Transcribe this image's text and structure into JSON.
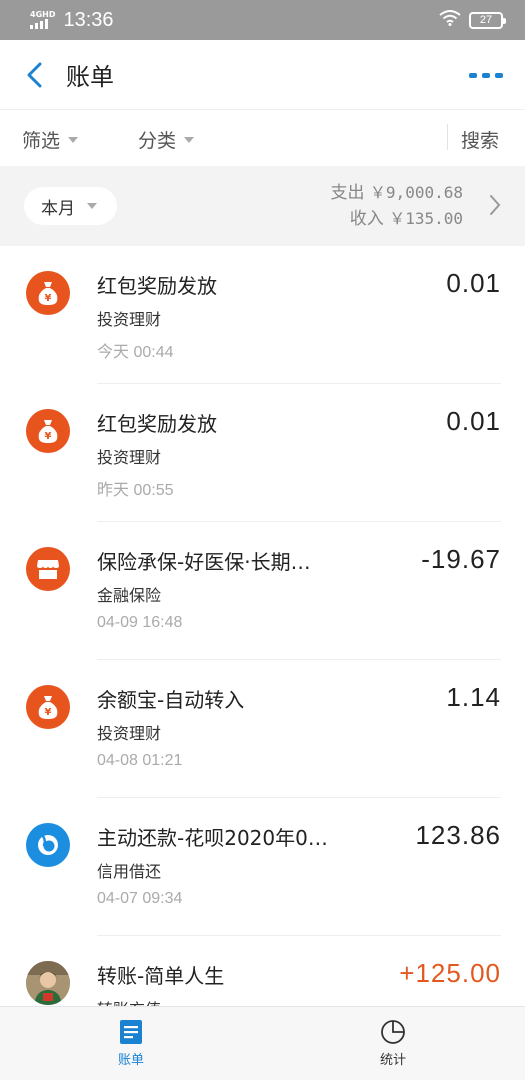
{
  "status_bar": {
    "network": "4GHD",
    "time": "13:36",
    "battery": "27"
  },
  "header": {
    "title": "账单"
  },
  "filters": {
    "filter_label": "筛选",
    "category_label": "分类",
    "search_label": "搜索"
  },
  "summary": {
    "month_label": "本月",
    "expense_label": "支出",
    "expense_value": "￥9,000.68",
    "income_label": "收入",
    "income_value": "￥135.00"
  },
  "transactions": [
    {
      "title": "红包奖励发放",
      "category": "投资理财",
      "time": "今天  00:44",
      "amount": "0.01",
      "icon": "money-bag-icon",
      "icon_color": "#e8541e"
    },
    {
      "title": "红包奖励发放",
      "category": "投资理财",
      "time": "昨天  00:55",
      "amount": "0.01",
      "icon": "money-bag-icon",
      "icon_color": "#e8541e"
    },
    {
      "title": "保险承保-好医保·长期…",
      "category": "金融保险",
      "time": "04-09  16:48",
      "amount": "-19.67",
      "icon": "shop-icon",
      "icon_color": "#e8541e"
    },
    {
      "title": "余额宝-自动转入",
      "category": "投资理财",
      "time": "04-08  01:21",
      "amount": "1.14",
      "icon": "money-bag-icon",
      "icon_color": "#e8541e"
    },
    {
      "title": "主动还款-花呗2020年0…",
      "category": "信用借还",
      "time": "04-07  09:34",
      "amount": "123.86",
      "icon": "huabei-icon",
      "icon_color": "#1b8ee0"
    },
    {
      "title": "转账-简单人生",
      "category": "转账充值",
      "time": "",
      "amount": "+125.00",
      "icon": "avatar",
      "icon_color": "#e2581f"
    }
  ],
  "tabs": [
    {
      "label": "账单",
      "icon": "bill-icon",
      "active": true
    },
    {
      "label": "统计",
      "icon": "pie-chart-icon",
      "active": false
    }
  ],
  "colors": {
    "accent": "#1b82d2",
    "orange": "#e8541e",
    "income": "#e2581f",
    "gray_bg": "#f3f3f3"
  }
}
